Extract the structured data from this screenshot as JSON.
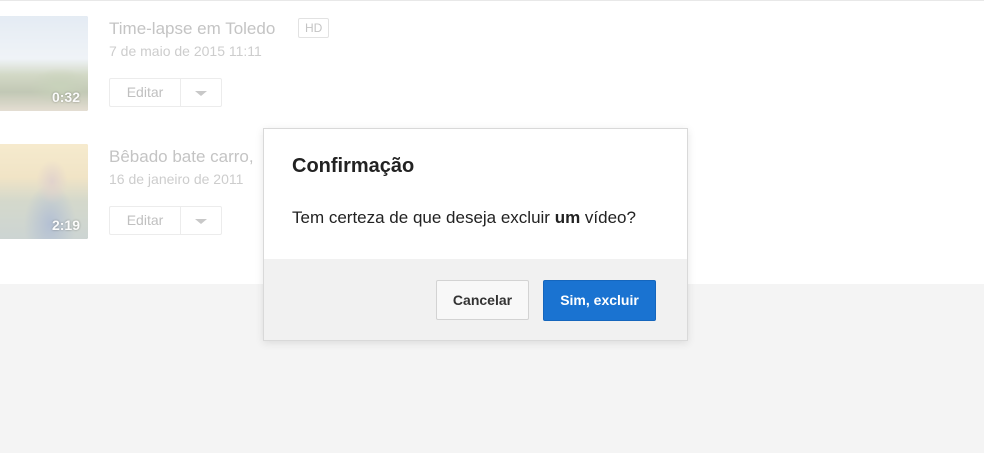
{
  "videos": [
    {
      "title": "Time-lapse em Toledo",
      "badge": "HD",
      "date": "7 de maio de 2015 11:11",
      "duration": "0:32",
      "edit_label": "Editar"
    },
    {
      "title": "Bêbado bate carro,",
      "date": "16 de janeiro de 2011",
      "duration": "2:19",
      "edit_label": "Editar"
    }
  ],
  "dialog": {
    "title": "Confirmação",
    "message_before": "Tem certeza de que deseja excluir ",
    "message_bold": "um",
    "message_after": " vídeo?",
    "cancel_label": "Cancelar",
    "confirm_label": "Sim, excluir"
  },
  "colors": {
    "primary": "#1a73d1",
    "dialog_footer": "#f1f1f1"
  },
  "icons": [
    "dropdown-caret-icon"
  ]
}
